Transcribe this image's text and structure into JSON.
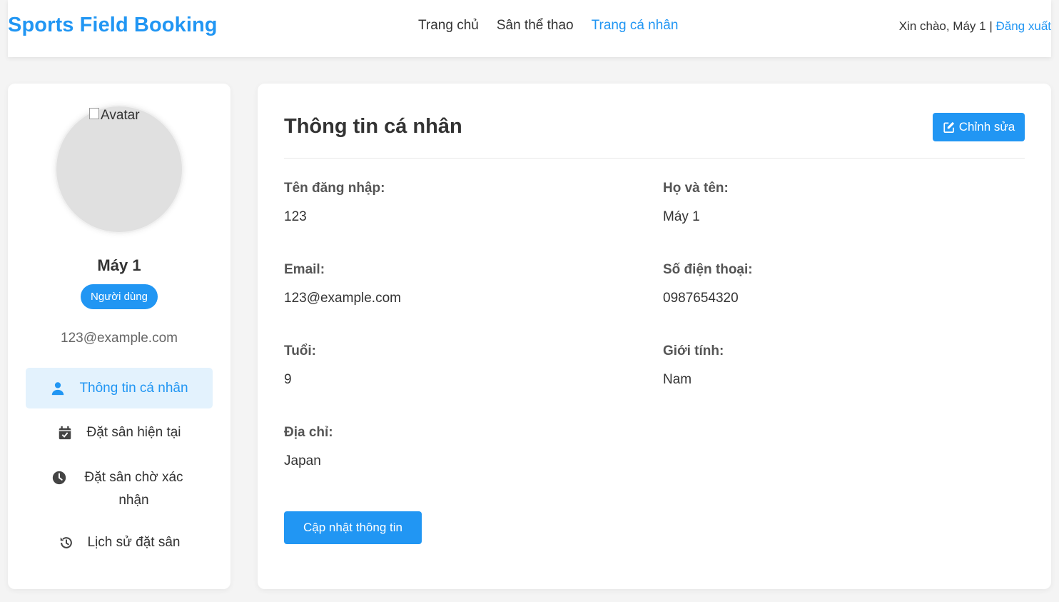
{
  "header": {
    "brand": "Sports Field Booking",
    "nav": [
      {
        "label": "Trang chủ"
      },
      {
        "label": "Sân thể thao"
      },
      {
        "label": "Trang cá nhân"
      }
    ],
    "greeting": "Xin chào, Máy 1",
    "separator": "|",
    "logout_label": "Đăng xuất"
  },
  "sidebar": {
    "avatar_alt": "Avatar",
    "name": "Máy 1",
    "role": "Người dùng",
    "email": "123@example.com",
    "menu": [
      {
        "label": "Thông tin cá nhân",
        "icon": "user-icon"
      },
      {
        "label": "Đặt sân hiện tại",
        "icon": "calendar-check-icon"
      },
      {
        "label": "Đặt sân chờ xác nhận",
        "icon": "clock-icon"
      },
      {
        "label": "Lịch sử đặt sân",
        "icon": "history-icon"
      }
    ]
  },
  "main": {
    "title": "Thông tin cá nhân",
    "edit_label": "Chỉnh sửa",
    "fields": [
      {
        "label": "Tên đăng nhập:",
        "value": "123"
      },
      {
        "label": "Họ và tên:",
        "value": "Máy 1"
      },
      {
        "label": "Email:",
        "value": "123@example.com"
      },
      {
        "label": "Số điện thoại:",
        "value": "0987654320"
      },
      {
        "label": "Tuổi:",
        "value": "9"
      },
      {
        "label": "Giới tính:",
        "value": "Nam"
      },
      {
        "label": "Địa chỉ:",
        "value": "Japan"
      }
    ],
    "update_label": "Cập nhật thông tin"
  },
  "colors": {
    "accent": "#2196f3",
    "active_menu_bg": "#e3f2fd",
    "page_bg": "#f4f4f4"
  }
}
